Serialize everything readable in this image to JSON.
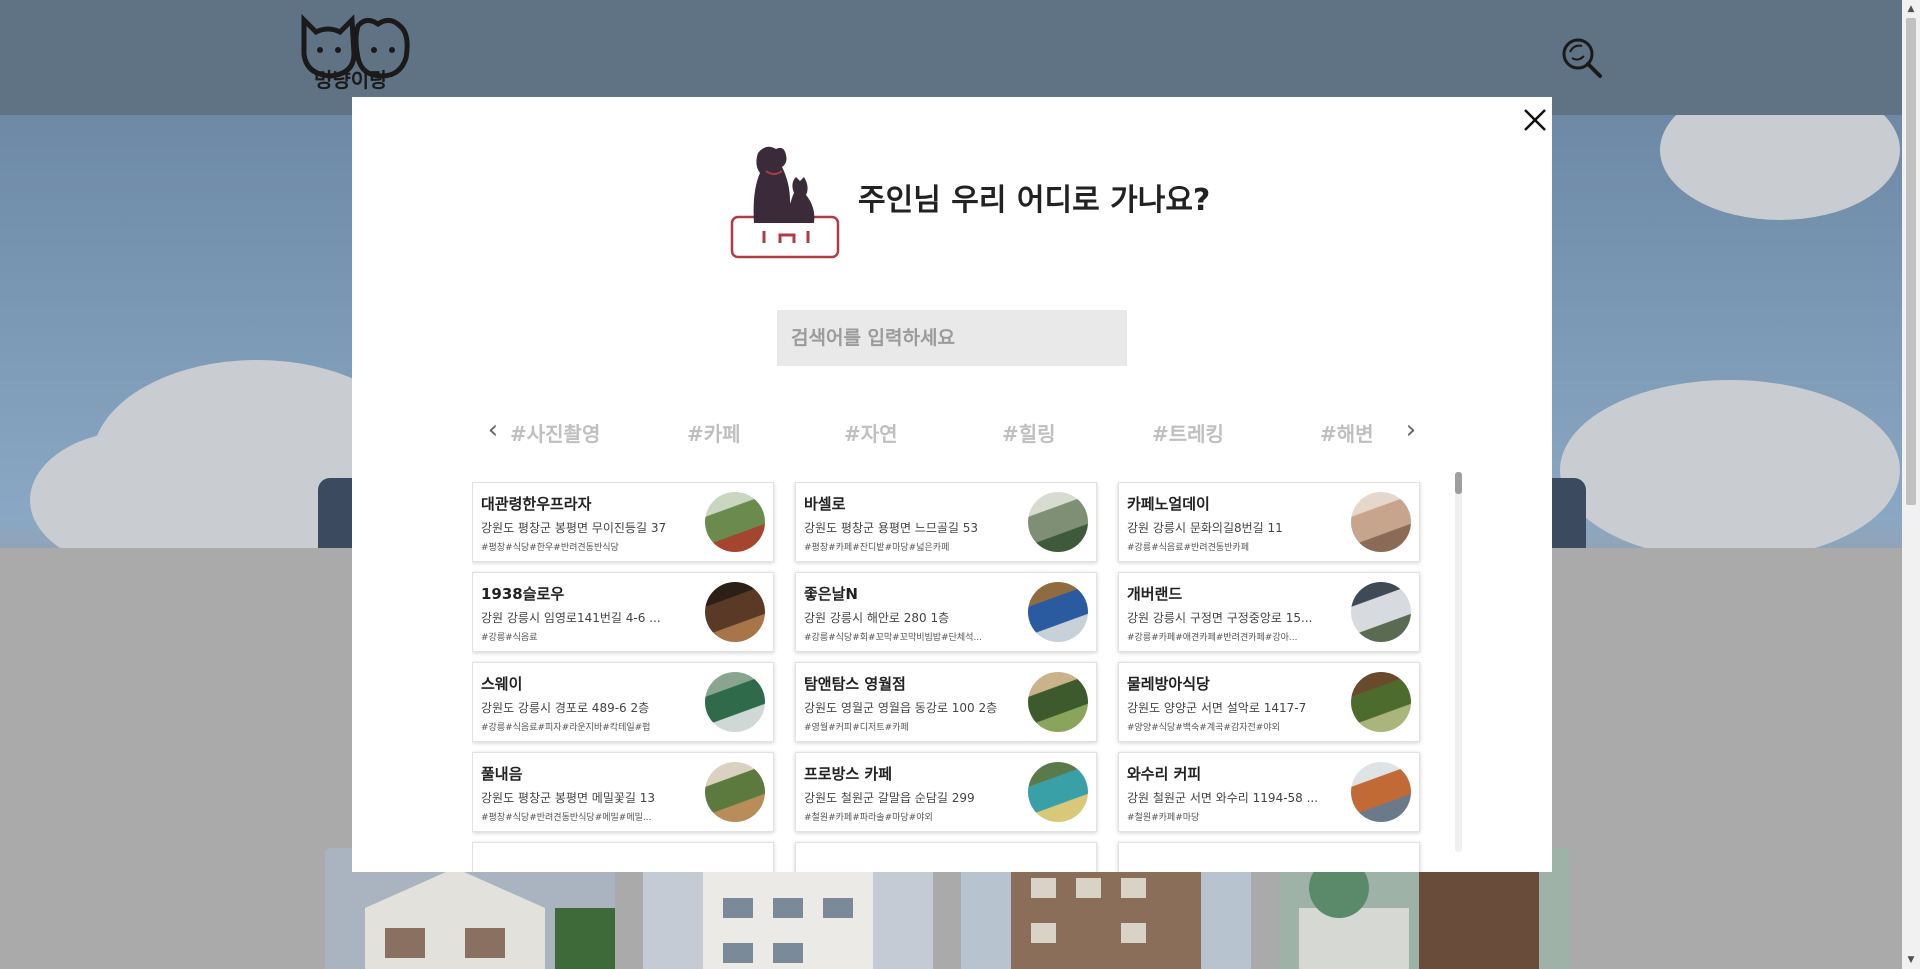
{
  "header": {
    "logo_text": "멍냥이랑"
  },
  "modal": {
    "title": "주인님 우리 어디로 가나요?",
    "search_placeholder": "검색어를 입력하세요",
    "tags": [
      "#사진촬영",
      "#카페",
      "#자연",
      "#힐링",
      "#트레킹",
      "#해변"
    ],
    "places": [
      {
        "name": "대관령한우프라자",
        "addr": "강원도 평창군 봉평면 무이진등길 37",
        "tags": "#평창#식당#한우#반려견동반식당",
        "img_colors": [
          "#6b8a4e",
          "#a4452f",
          "#c9d6c0"
        ]
      },
      {
        "name": "바셀로",
        "addr": "강원도 평창군 용평면 느므골길 53",
        "tags": "#평창#카페#잔디밭#마당#넓은카페",
        "img_colors": [
          "#7f8f75",
          "#3f5a3a",
          "#d7dbd0"
        ]
      },
      {
        "name": "카페노얼데이",
        "addr": "강원 강릉시 문화의길8번길 11",
        "tags": "#강릉#식음료#반려견동반카페",
        "img_colors": [
          "#c7a48c",
          "#8b6a57",
          "#e6d7cc"
        ]
      },
      {
        "name": "1938슬로우",
        "addr": "강원 강릉시 임영로141번길 4-6 ...",
        "tags": "#강릉#식음료",
        "img_colors": [
          "#5a3a26",
          "#a87549",
          "#2c1f16"
        ]
      },
      {
        "name": "좋은날N",
        "addr": "강원 강릉시 해안로 280 1층",
        "tags": "#강릉#식당#회#꼬막#꼬막비빔밥#단체석...",
        "img_colors": [
          "#2a5ba0",
          "#c8d0d8",
          "#8f6c3f"
        ]
      },
      {
        "name": "개버랜드",
        "addr": "강원 강릉시 구정면 구정중앙로 15...",
        "tags": "#강릉#카페#애견카페#반려견카페#강아...",
        "img_colors": [
          "#d7dbe0",
          "#5b6b52",
          "#3e4a56"
        ]
      },
      {
        "name": "스웨이",
        "addr": "강원도 강릉시 경포로 489-6 2층",
        "tags": "#강릉#식음료#피자#라운지바#칵테일#펍",
        "img_colors": [
          "#2f6a4a",
          "#d0d8d6",
          "#8aa58f"
        ]
      },
      {
        "name": "탐앤탐스 영월점",
        "addr": "강원도 영월군 영월읍 동강로 100 2층",
        "tags": "#영월#커피#디저트#카페",
        "img_colors": [
          "#3d5a2c",
          "#8aa45c",
          "#c9b38a"
        ]
      },
      {
        "name": "물레방아식당",
        "addr": "강원도 양양군 서면 설악로 1417-7",
        "tags": "#양양#식당#백숙#계곡#감자전#야외",
        "img_colors": [
          "#4e6b2e",
          "#a9b57a",
          "#6a4a2c"
        ]
      },
      {
        "name": "풀내음",
        "addr": "강원도 평창군 봉평면 메밀꽃길 13",
        "tags": "#평창#식당#반려견동반식당#메밀#메밀...",
        "img_colors": [
          "#5c7a3e",
          "#b88d5a",
          "#d9d2c0"
        ]
      },
      {
        "name": "프로방스 카페",
        "addr": "강원도 철원군 갈말읍 순담길 299",
        "tags": "#철원#카페#파라솔#마당#야외",
        "img_colors": [
          "#3aa0a8",
          "#d9c87a",
          "#5a7a4a"
        ]
      },
      {
        "name": "와수리 커피",
        "addr": "강원 철원군 서면 와수리 1194-58 ...",
        "tags": "#철원#카페#마당",
        "img_colors": [
          "#c26a36",
          "#6a7a8a",
          "#dfe3e6"
        ]
      }
    ]
  },
  "colors": {
    "header_bg": "#5f7384",
    "modal_bg": "#ffffff",
    "search_bg": "#e9e9e9",
    "tag_color": "#bfbfbf"
  }
}
